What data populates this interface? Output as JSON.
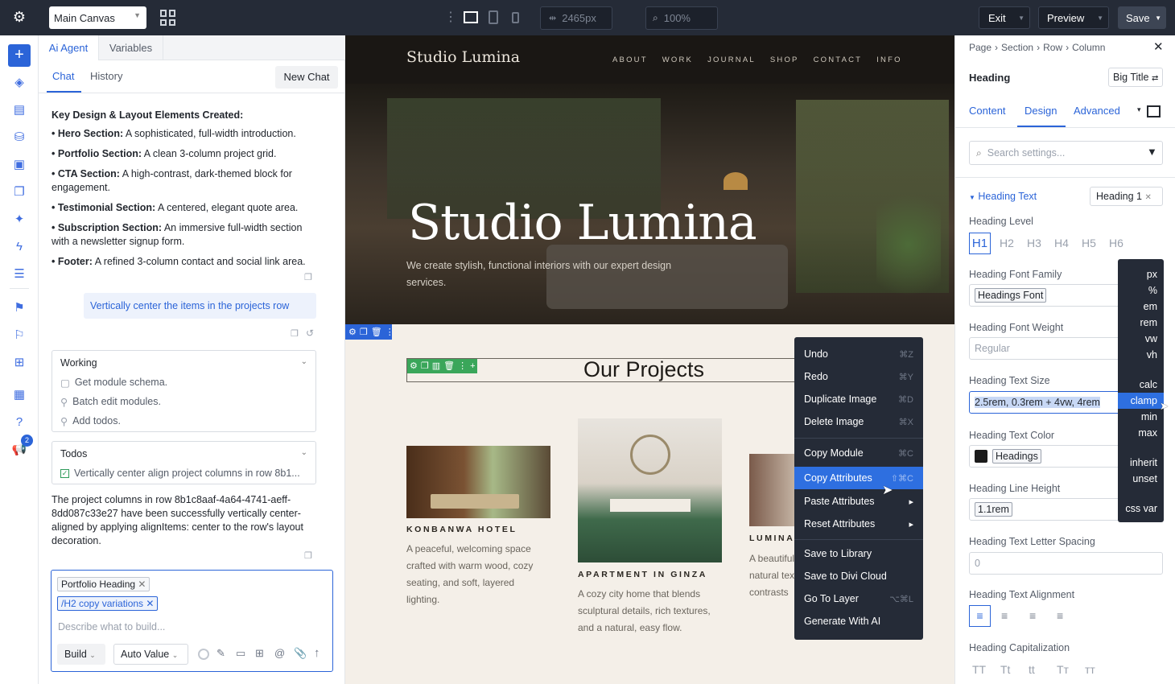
{
  "topbar": {
    "canvas_select": "Main Canvas",
    "width_field": "2465px",
    "zoom_field": "100%",
    "exit": "Exit",
    "preview": "Preview",
    "save": "Save"
  },
  "panel": {
    "tabs": [
      "Ai Agent",
      "Variables"
    ],
    "subtabs": [
      "Chat",
      "History"
    ],
    "new_chat": "New Chat",
    "summary_title": "Key Design & Layout Elements Created:",
    "bullets": [
      {
        "b": "• Hero Section:",
        "t": " A sophisticated, full-width introduction."
      },
      {
        "b": "• Portfolio Section:",
        "t": " A clean 3-column project grid."
      },
      {
        "b": "• CTA Section:",
        "t": " A high-contrast, dark-themed block for engagement."
      },
      {
        "b": "• Testimonial Section:",
        "t": " A centered, elegant quote area."
      },
      {
        "b": "• Subscription Section:",
        "t": " An immersive full-width section with a newsletter signup form."
      },
      {
        "b": "• Footer:",
        "t": " A refined 3-column contact and social link area."
      }
    ],
    "user_msg": "Vertically center the items in the projects row",
    "working": {
      "title": "Working",
      "items": [
        "Get module schema.",
        "Batch edit modules.",
        "Add todos."
      ]
    },
    "todos": {
      "title": "Todos",
      "items": [
        "Vertically center align project columns in row 8b1..."
      ]
    },
    "result": "The project columns in row 8b1c8aaf-4a64-4741-aeff-8dd087c33e27 have been successfully vertically center-aligned by applying alignItems: center to the row's layout decoration.",
    "composer": {
      "chip1": "Portfolio Heading",
      "chip2": "/H2 copy variations",
      "placeholder": "Describe what to build...",
      "build": "Build",
      "auto": "Auto Value"
    },
    "badge": "2"
  },
  "canvas": {
    "logo": "Studio Lumina",
    "nav": [
      "ABOUT",
      "WORK",
      "JOURNAL",
      "SHOP",
      "CONTACT",
      "INFO"
    ],
    "hero_title": "Studio Lumina",
    "hero_sub": "We create stylish, functional interiors with our expert design services.",
    "section_title": "Our Projects",
    "projects": [
      {
        "title": "KONBANWA HOTEL",
        "desc": "A peaceful, welcoming space crafted with warm wood, cozy seating, and soft, layered lighting."
      },
      {
        "title": "APARTMENT IN GINZA",
        "desc": "A cozy city home that blends sculptural details, rich textures, and a natural, easy flow."
      },
      {
        "title": "LUMINA",
        "desc": "A beautiful natural tex contrasts"
      }
    ]
  },
  "context_menu": [
    {
      "label": "Undo",
      "sc": "⌘Z"
    },
    {
      "label": "Redo",
      "sc": "⌘Y"
    },
    {
      "label": "Duplicate Image",
      "sc": "⌘D"
    },
    {
      "label": "Delete Image",
      "sc": "⌘X"
    },
    {
      "label": "Copy Module",
      "sc": "⌘C"
    },
    {
      "label": "Copy Attributes",
      "sc": "⇧⌘C"
    },
    {
      "label": "Paste Attributes",
      "sc": "▸"
    },
    {
      "label": "Reset Attributes",
      "sc": "▸"
    },
    {
      "label": "Save to Library",
      "sc": ""
    },
    {
      "label": "Save to Divi Cloud",
      "sc": ""
    },
    {
      "label": "Go To Layer",
      "sc": "⌥⌘L"
    },
    {
      "label": "Generate With AI",
      "sc": ""
    }
  ],
  "right": {
    "breadcrumb": [
      "Page",
      "Section",
      "Row",
      "Column"
    ],
    "module": "Heading",
    "preset": "Big Title",
    "tabs": [
      "Content",
      "Design",
      "Advanced"
    ],
    "search_placeholder": "Search settings...",
    "group": "Heading Text",
    "group_chip": "Heading 1",
    "level_label": "Heading Level",
    "levels": [
      "H1",
      "H2",
      "H3",
      "H4",
      "H5",
      "H6"
    ],
    "font_family_label": "Heading Font Family",
    "font_family": "Headings Font",
    "font_weight_label": "Heading Font Weight",
    "font_weight": "Regular",
    "text_size_label": "Heading Text Size",
    "text_size": "2.5rem, 0.3rem + 4vw, 4rem",
    "color_label": "Heading Text Color",
    "color_value": "Headings",
    "line_height_label": "Heading Line Height",
    "line_height": "1.1rem",
    "letter_spacing_label": "Heading Text Letter Spacing",
    "letter_spacing": "0",
    "alignment_label": "Heading Text Alignment",
    "capitalization_label": "Heading Capitalization",
    "caps": [
      "TT",
      "Tt",
      "tt",
      "Tт",
      "ᴛᴛ"
    ]
  },
  "units": [
    "px",
    "%",
    "em",
    "rem",
    "vw",
    "vh",
    "calc",
    "clamp",
    "min",
    "max",
    "inherit",
    "unset",
    "css var"
  ],
  "colors": {
    "accent": "#2b64d8",
    "dark": "#252b37",
    "menu_hl": "#2e6fe0"
  }
}
